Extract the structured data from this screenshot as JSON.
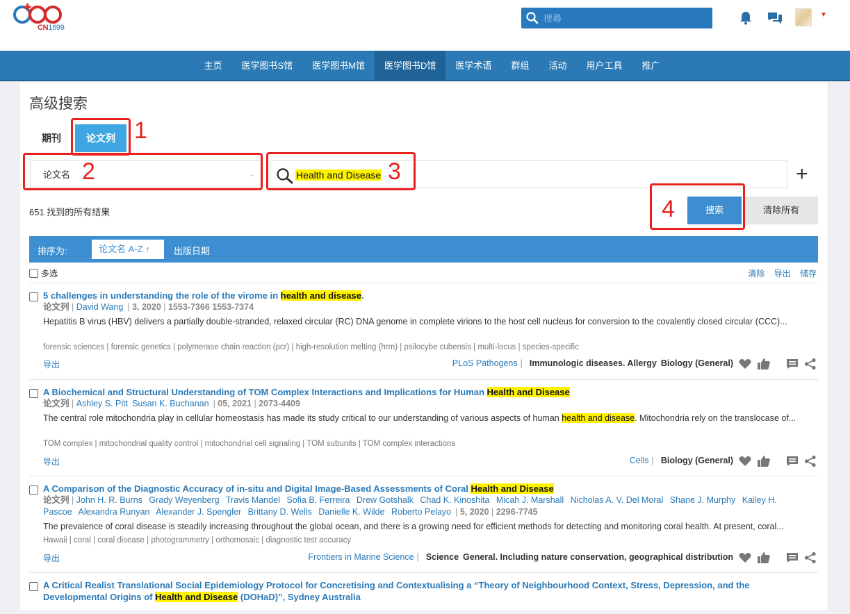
{
  "header": {
    "logo_text": "CN",
    "logo_num": "1699",
    "search_placeholder": "搜尋"
  },
  "nav": [
    {
      "label": "主页",
      "active": false
    },
    {
      "label": "医学图书S馆",
      "active": false
    },
    {
      "label": "医学图书M馆",
      "active": false
    },
    {
      "label": "医学图书D馆",
      "active": true
    },
    {
      "label": "医学术语",
      "active": false
    },
    {
      "label": "群组",
      "active": false
    },
    {
      "label": "活动",
      "active": false
    },
    {
      "label": "用户工具",
      "active": false
    },
    {
      "label": "推广",
      "active": false
    }
  ],
  "page": {
    "title": "高级搜索",
    "tab_journal": "期刊",
    "tab_paper": "论文列",
    "field_select": "论文名",
    "query": "Health and Disease",
    "result_count": "651 找到的所有结果",
    "search_btn": "搜索",
    "clear_btn": "清除所有",
    "sort_label": "排序为:",
    "sort_title": "论文名 A-Z",
    "sort_date": "出版日期",
    "multi_select": "多选",
    "actions": [
      "清除",
      "导出",
      "储存"
    ]
  },
  "annotations": {
    "n1": "1",
    "n2": "2",
    "n3": "3",
    "n4": "4"
  },
  "colors": {
    "accent": "#2b7ab5",
    "highlight": "#fff200",
    "annotation": "#e8201e"
  },
  "results": [
    {
      "title_pre": "5 challenges in understanding the role of the virome in ",
      "title_hl": "health and disease",
      "title_post": ".",
      "type": "论文列",
      "authors": [
        "David Wang"
      ],
      "date": "3, 2020",
      "issn": "1553-7366 1553-7374",
      "abstract": "Hepatitis B virus (HBV) delivers a partially double-stranded, relaxed circular (RC) DNA genome in complete virions to the host cell nucleus for conversion to the covalently closed circular (CCC)...",
      "keywords": "forensic sciences | forensic genetics | polymerase chain reaction (pcr) | high-resolution melting (hrm) | psilocybe cubensis | multi-locus | species-specific",
      "export": "导出",
      "source": "PLoS Pathogens",
      "cats": [
        "Immunologic diseases. Allergy",
        "Biology (General)"
      ]
    },
    {
      "title_pre": "A Biochemical and Structural Understanding of TOM Complex Interactions and Implications for Human ",
      "title_hl": "Health and Disease",
      "title_post": "",
      "type": "论文列",
      "authors": [
        "Ashley S. Pitt",
        "Susan K. Buchanan"
      ],
      "date": "05, 2021",
      "issn": "2073-4409",
      "abstract_pre": "The central role mitochondria play in cellular homeostasis has made its study critical to our understanding of various aspects of human ",
      "abstract_hl": "health and disease",
      "abstract_post": ". Mitochondria rely on the translocase of...",
      "keywords": "TOM complex | mitochondrial quality control | mitochondrial cell signaling | TOM subunits | TOM complex interactions",
      "export": "导出",
      "source": "Cells",
      "cats": [
        "Biology (General)"
      ]
    },
    {
      "title_pre": "A Comparison of the Diagnostic Accuracy of in-situ and Digital Image-Based Assessments of Coral ",
      "title_hl": "Health and Disease",
      "title_post": "",
      "type": "论文列",
      "authors": [
        "John H. R. Burns",
        "Grady Weyenberg",
        "Travis Mandel",
        "Sofia B. Ferreira",
        "Drew Gotshalk",
        "Chad K. Kinoshita",
        "Micah J. Marshall",
        "Nicholas A. V. Del Moral",
        "Shane J. Murphy",
        "Kailey H. Pascoe",
        "Alexandra Runyan",
        "Alexander J. Spengler",
        "Brittany D. Wells",
        "Danielle K. Wilde",
        "Roberto Pelayo"
      ],
      "date": "5, 2020",
      "issn": "2296-7745",
      "abstract": "The prevalence of coral disease is steadily increasing throughout the global ocean, and there is a growing need for efficient methods for detecting and monitoring coral health. At present, coral...",
      "keywords": "Hawaii | coral | coral disease | photogrammetry | orthomosaic | diagnostic test accuracy",
      "export": "导出",
      "source": "Frontiers in Marine Science",
      "cats": [
        "Science",
        "General. Including nature conservation, geographical distribution"
      ]
    },
    {
      "title_pre": "A Critical Realist Translational Social Epidemiology Protocol for Concretising and Contextualising a “Theory of Neighbourhood Context, Stress, Depression, and the Developmental Origins of ",
      "title_hl": "Health and Disease",
      "title_post": " (DOHaD)”, Sydney Australia"
    }
  ]
}
